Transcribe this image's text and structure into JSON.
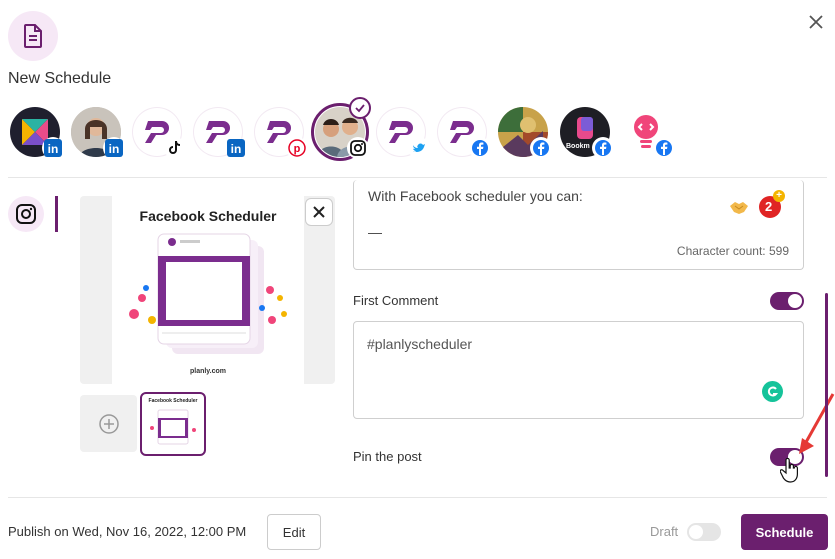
{
  "header": {
    "title": "New Schedule"
  },
  "accounts": [
    {
      "network": "linkedin",
      "avatar": "logo-multicolor"
    },
    {
      "network": "linkedin",
      "avatar": "photo-woman"
    },
    {
      "network": "tiktok",
      "avatar": "planly-logo"
    },
    {
      "network": "linkedin",
      "avatar": "planly-logo"
    },
    {
      "network": "pinterest",
      "avatar": "planly-logo"
    },
    {
      "network": "instagram",
      "avatar": "photo-two-men",
      "selected": true
    },
    {
      "network": "twitter",
      "avatar": "planly-logo"
    },
    {
      "network": "facebook",
      "avatar": "planly-logo"
    },
    {
      "network": "facebook",
      "avatar": "painting"
    },
    {
      "network": "facebook",
      "avatar": "bookmark-logo",
      "avatar_text": "Bookm"
    },
    {
      "network": "facebook",
      "avatar": "lightbulb-code"
    }
  ],
  "preview": {
    "title": "Facebook Scheduler",
    "footer": "planly.com"
  },
  "thumbnail": {
    "title": "Facebook Scheduler"
  },
  "caption": {
    "text": "With Facebook scheduler you can:",
    "dash": "—",
    "char_count_label": "Character count:",
    "char_count": "599"
  },
  "first_comment": {
    "label": "First Comment",
    "enabled": true,
    "text": "#planlyscheduler"
  },
  "pin_post": {
    "label": "Pin the post",
    "enabled": true
  },
  "footer": {
    "publish_text": "Publish on Wed, Nov 16, 2022, 12:00 PM",
    "edit_label": "Edit",
    "draft_label": "Draft",
    "draft_enabled": false,
    "schedule_label": "Schedule"
  },
  "colors": {
    "brand": "#6b1f6e",
    "brand_light": "#f6e8f6",
    "grammarly": "#15c39a",
    "annotation_arrow": "#e53935"
  }
}
